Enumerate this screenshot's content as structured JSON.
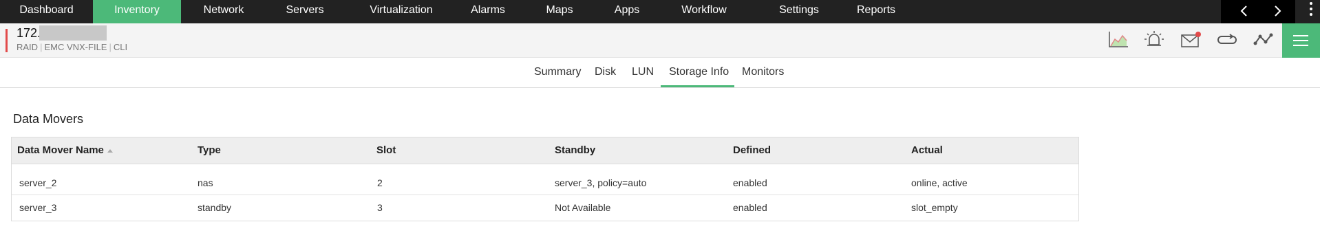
{
  "topnav": {
    "items": [
      "Dashboard",
      "Inventory",
      "Network",
      "Servers",
      "Virtualization",
      "Alarms",
      "Maps",
      "Apps",
      "Workflow",
      "Settings",
      "Reports"
    ],
    "active": "Inventory"
  },
  "device": {
    "ip": "172.",
    "tags": [
      "RAID",
      "EMC VNX-FILE",
      "CLI"
    ]
  },
  "icons": {
    "header": [
      "chart-icon",
      "alarm-bell-icon",
      "mail-icon",
      "sync-icon",
      "topology-icon",
      "menu-icon"
    ],
    "colors": {
      "accent": "#4cb979",
      "topbar": "#222222",
      "alert": "#e24a4a"
    }
  },
  "tabs": {
    "items": [
      "Summary",
      "Disk",
      "LUN",
      "Storage Info",
      "Monitors"
    ],
    "active": "Storage Info"
  },
  "section": {
    "title": "Data Movers"
  },
  "table": {
    "columns": [
      "Data Mover Name",
      "Type",
      "Slot",
      "Standby",
      "Defined",
      "Actual"
    ],
    "rows": [
      [
        "server_2",
        "nas",
        "2",
        "server_3, policy=auto",
        "enabled",
        "online, active"
      ],
      [
        "server_3",
        "standby",
        "3",
        "Not Available",
        "enabled",
        "slot_empty"
      ]
    ]
  }
}
